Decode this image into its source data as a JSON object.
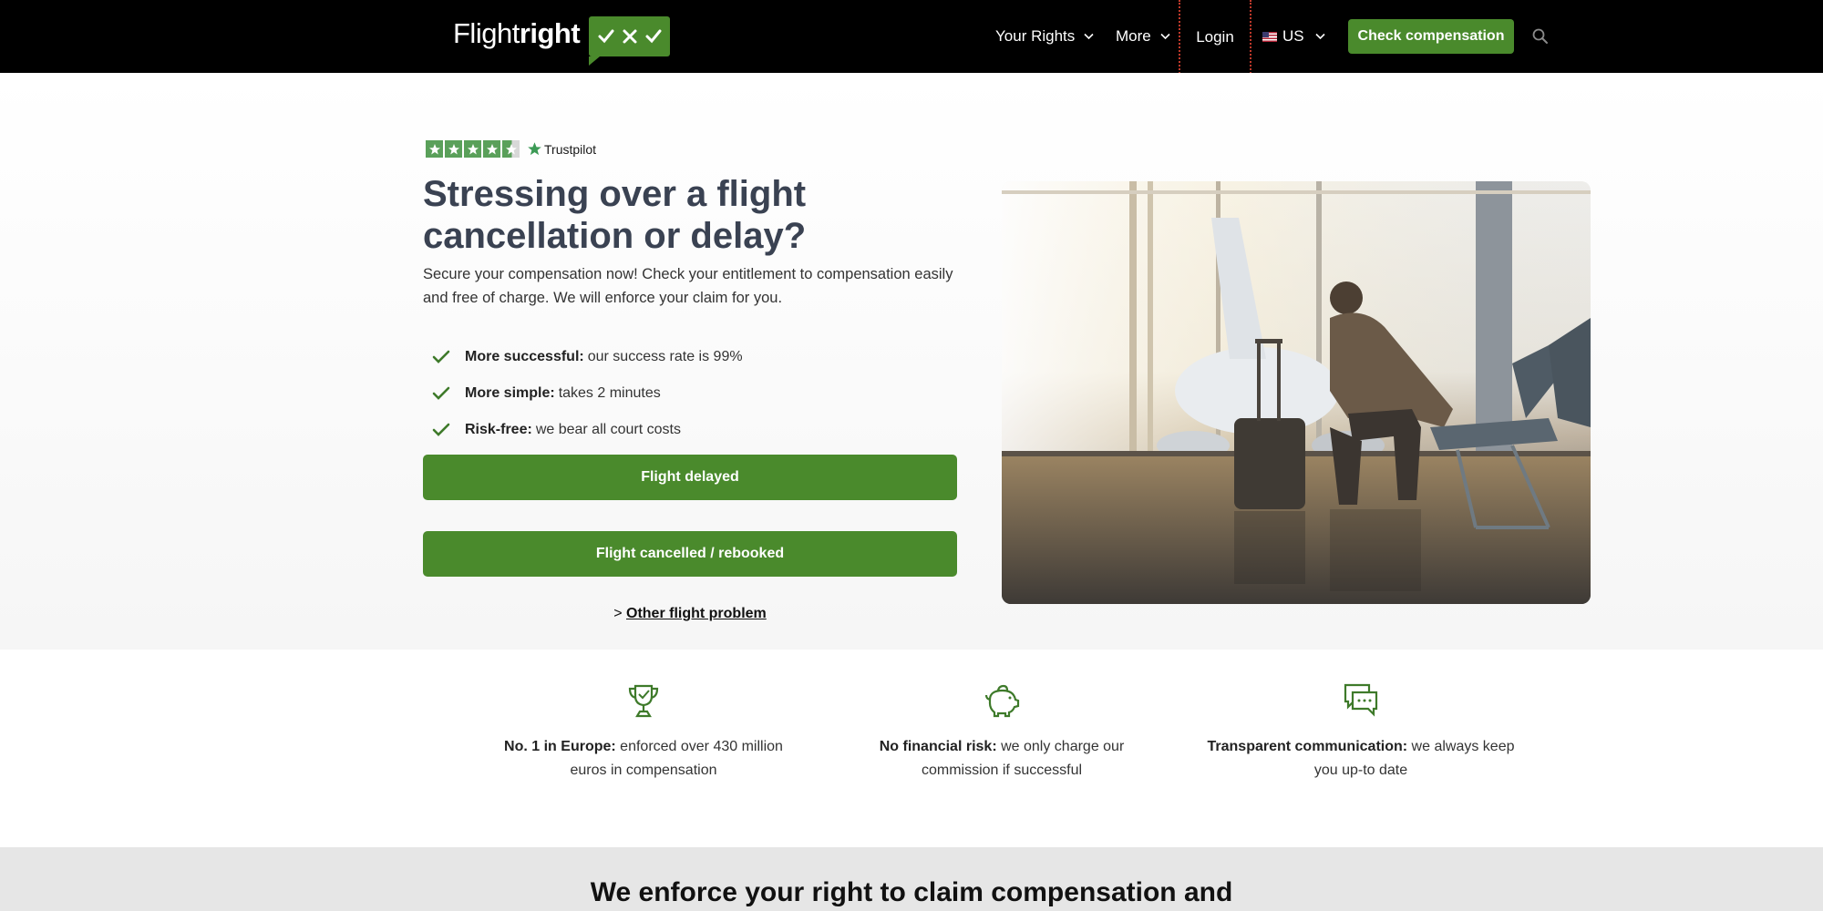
{
  "header": {
    "logo_light": "Flight",
    "logo_bold": "right",
    "nav": {
      "rights": "Your Rights",
      "more": "More",
      "login": "Login",
      "lang": "US"
    },
    "cta": "Check compensation",
    "search_icon": "search-icon"
  },
  "hero": {
    "trustpilot_label": "Trustpilot",
    "trustpilot_rating": 4.5,
    "title": "Stressing over a flight cancellation or delay?",
    "subtitle": "Secure your compensation now! Check your entitlement to compensation easily and free of charge. We will enforce your claim for you.",
    "benefits": [
      {
        "bold": "More successful:",
        "text": "our success rate is 99%"
      },
      {
        "bold": "More simple:",
        "text": "takes 2 minutes"
      },
      {
        "bold": "Risk-free:",
        "text": "we bear all court costs"
      }
    ],
    "btn_delayed": "Flight delayed",
    "btn_cancelled": "Flight cancelled / rebooked",
    "other_prefix": ">",
    "other_link": "Other flight problem"
  },
  "features": [
    {
      "icon": "trophy-icon",
      "bold": "No. 1 in Europe:",
      "text": "enforced over 430 million euros in compensation"
    },
    {
      "icon": "piggy-bank-icon",
      "bold": "No financial risk:",
      "text": "we only charge our commission if successful"
    },
    {
      "icon": "chat-icon",
      "bold": "Transparent communication:",
      "text": "we always keep you up-to date"
    }
  ],
  "band": {
    "title": "We enforce your right to claim compensation and"
  },
  "colors": {
    "brand_green": "#4a8a2c",
    "header_bg": "#000000",
    "title_color": "#3a4252",
    "trustpilot_green": "#5aa05a"
  }
}
